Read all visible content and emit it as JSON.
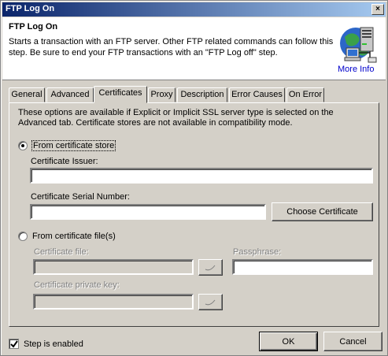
{
  "window": {
    "title": "FTP Log On",
    "close_glyph": "×"
  },
  "header": {
    "title": "FTP Log On",
    "description": "Starts a transaction with an FTP server.  Other FTP related commands can follow this step.  Be sure to end your FTP transactions with an \"FTP Log off\" step.",
    "more_info": "More Info",
    "icon": "network-computer-icon"
  },
  "tabs": [
    {
      "label": "General",
      "active": false
    },
    {
      "label": "Advanced",
      "active": false
    },
    {
      "label": "Certificates",
      "active": true
    },
    {
      "label": "Proxy",
      "active": false
    },
    {
      "label": "Description",
      "active": false
    },
    {
      "label": "Error Causes",
      "active": false
    },
    {
      "label": "On Error",
      "active": false
    }
  ],
  "certificates": {
    "note": "These options are available if Explicit or Implicit SSL server type is selected on the Advanced tab.  Certificate stores are not available in compatibility mode.",
    "store_option": {
      "label": "From certificate store",
      "checked": true
    },
    "issuer": {
      "label": "Certificate Issuer:",
      "value": ""
    },
    "serial": {
      "label": "Certificate Serial Number:",
      "value": ""
    },
    "choose_button": "Choose Certificate",
    "file_option": {
      "label": "From certificate file(s)",
      "checked": false
    },
    "cert_file": {
      "label": "Certificate file:",
      "value": ""
    },
    "passphrase": {
      "label": "Passphrase:",
      "value": ""
    },
    "private_key": {
      "label": "Certificate private key:",
      "value": ""
    }
  },
  "footer": {
    "step_enabled": {
      "label": "Step is enabled",
      "checked": true
    },
    "ok": "OK",
    "cancel": "Cancel"
  }
}
